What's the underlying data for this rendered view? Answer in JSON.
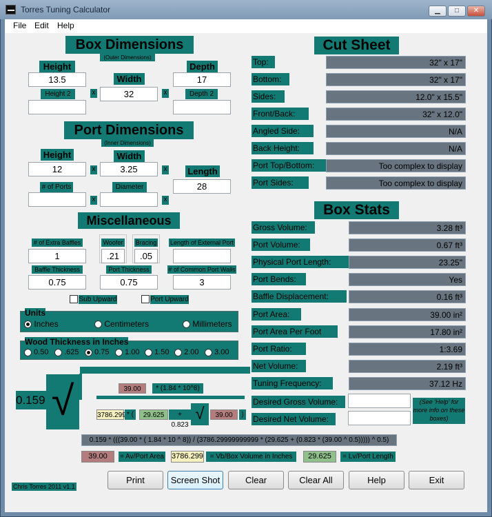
{
  "window": {
    "title": "Torres Tuning Calculator",
    "min": "▁",
    "max": "□",
    "close": "✕"
  },
  "menu": [
    "File",
    "Edit",
    "Help"
  ],
  "box_dims": {
    "title": "Box Dimensions",
    "subtitle": "(Outer Dimensions)",
    "height_label": "Height",
    "height": "13.5",
    "width_label": "Width",
    "width": "32",
    "depth_label": "Depth",
    "depth": "17",
    "height2_label": "Height 2",
    "height2": "",
    "depth2_label": "Depth 2",
    "depth2": "",
    "x": "x"
  },
  "port_dims": {
    "title": "Port Dimensions",
    "subtitle": "(Inner Dimensions)",
    "height_label": "Height",
    "height": "12",
    "width_label": "Width",
    "width": "3.25",
    "length_label": "Length",
    "length": "28",
    "ports_label": "# of Ports",
    "ports": "",
    "diameter_label": "Diameter",
    "diameter": ""
  },
  "misc": {
    "title": "Miscellaneous",
    "extra_baffles_label": "# of Extra Baffles",
    "extra_baffles": "1",
    "woofer_label": "Woofer",
    "woofer": ".21",
    "bracing_label": "Bracing",
    "bracing": ".05",
    "ext_port_label": "Length of External Port",
    "ext_port": "",
    "baffle_thick_label": "Baffle Thickness",
    "baffle_thick": "0.75",
    "port_thick_label": "Port Thickness",
    "port_thick": "0.75",
    "common_walls_label": "# of Common Port Walls",
    "common_walls": "3",
    "sub_upward": "Sub Upward",
    "port_upward": "Port Upward"
  },
  "units": {
    "title": "Units",
    "options": [
      "Inches",
      "Centimeters",
      "Millimeters"
    ],
    "selected": 0
  },
  "wood": {
    "title": "Wood Thickness in Inches",
    "options": [
      "0.50",
      ".625",
      "0.75",
      "1.00",
      "1.50",
      "2.00",
      "3.00"
    ],
    "selected": 2
  },
  "cut_sheet": {
    "title": "Cut Sheet",
    "rows": [
      {
        "label": "Top:",
        "value": "32\" x 17\""
      },
      {
        "label": "Bottom:",
        "value": "32\" x 17\""
      },
      {
        "label": "Sides:",
        "value": "12.0\" x 15.5\""
      },
      {
        "label": "Front/Back:",
        "value": "32\" x 12.0\""
      },
      {
        "label": "Angled Side:",
        "value": "N/A"
      },
      {
        "label": "Back Height:",
        "value": "N/A"
      },
      {
        "label": "Port Top/Bottom:",
        "value": "Too complex to display"
      },
      {
        "label": "Port Sides:",
        "value": "Too complex to display"
      }
    ]
  },
  "box_stats": {
    "title": "Box Stats",
    "rows": [
      {
        "label": "Gross Volume:",
        "value": "3.28 ft³"
      },
      {
        "label": "Port Volume:",
        "value": "0.67 ft³"
      },
      {
        "label": "Physical Port Length:",
        "value": "23.25\""
      },
      {
        "label": "Port Bends:",
        "value": "Yes"
      },
      {
        "label": "Baffle Displacement:",
        "value": "0.16 ft³"
      },
      {
        "label": "Port Area:",
        "value": "39.00 in²"
      },
      {
        "label": "Port Area Per Foot",
        "value": "17.80 in²"
      },
      {
        "label": "Port Ratio:",
        "value": "1:3.69"
      },
      {
        "label": "Net Volume:",
        "value": "2.19 ft³"
      },
      {
        "label": "Tuning Frequency:",
        "value": "37.12 Hz"
      }
    ],
    "desired_gross_label": "Desired Gross Volume:",
    "desired_gross": "",
    "desired_net_label": "Desired Net Volume:",
    "desired_net": "",
    "help_note": "(See 'Help' for more info on these boxes)"
  },
  "formula": {
    "coef": "0.159",
    "av": "39.00",
    "av_text": "* (1.84 * 10^8)",
    "vb": "3786.299",
    "mult": "* (",
    "lv": "29.625",
    "plus": "+ 0.823",
    "av2": "39.00",
    "close": ")",
    "sqrt": "√",
    "full": "0.159 * (((39.00 * ( 1.84 * 10 ^ 8)) / (3786.29999999999 * (29.625 + (0.823 * (39.00 ^ 0.5))))) ^ 0.5)",
    "legend_av": "39.00",
    "legend_av_text": "= Av/Port Area",
    "legend_vb": "3786.299",
    "legend_vb_text": "= Vb/Box Volume in Inches",
    "legend_lv": "29.625",
    "legend_lv_text": "= Lv/Port Length"
  },
  "footer": {
    "credit": "Chris Torres 2011 v1.1"
  },
  "buttons": [
    "Print",
    "Screen Shot",
    "Clear",
    "Clear All",
    "Help",
    "Exit"
  ]
}
